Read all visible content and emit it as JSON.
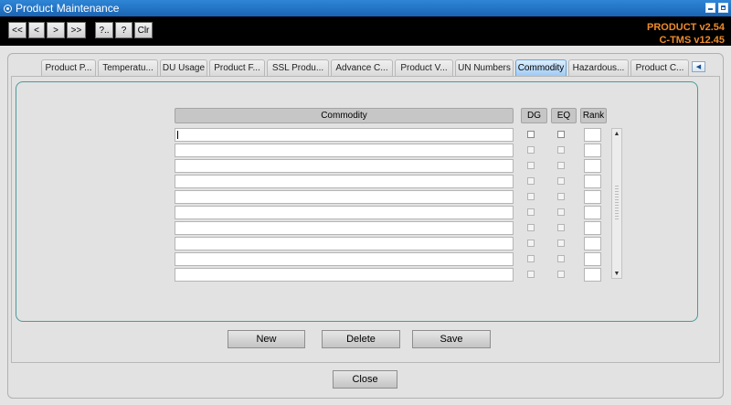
{
  "window": {
    "title": "Product Maintenance",
    "version_line1": "PRODUCT v2.54",
    "version_line2": "C-TMS v12.45"
  },
  "toolbar": {
    "first": "<<",
    "prev": "<",
    "next": ">",
    "last": ">>",
    "query_dots": "?..",
    "query": "?",
    "clear": "Clr"
  },
  "tabs": [
    {
      "label": "Product P...",
      "active": false
    },
    {
      "label": "Temperatu...",
      "active": false
    },
    {
      "label": "DU Usage",
      "active": false
    },
    {
      "label": "Product F...",
      "active": false
    },
    {
      "label": "SSL Produ...",
      "active": false
    },
    {
      "label": "Advance C...",
      "active": false
    },
    {
      "label": "Product V...",
      "active": false
    },
    {
      "label": "UN Numbers",
      "active": false
    },
    {
      "label": "Commodity",
      "active": true
    },
    {
      "label": "Hazardous...",
      "active": false
    },
    {
      "label": "Product C...",
      "active": false
    }
  ],
  "tab_scroll_icon": "chevron-left-icon",
  "grid": {
    "headers": {
      "commodity": "Commodity",
      "dg": "DG",
      "eq": "EQ",
      "rank": "Rank"
    },
    "rows": [
      {
        "commodity": "",
        "dg": false,
        "eq": false,
        "rank": ""
      },
      {
        "commodity": "",
        "dg": false,
        "eq": false,
        "rank": ""
      },
      {
        "commodity": "",
        "dg": false,
        "eq": false,
        "rank": ""
      },
      {
        "commodity": "",
        "dg": false,
        "eq": false,
        "rank": ""
      },
      {
        "commodity": "",
        "dg": false,
        "eq": false,
        "rank": ""
      },
      {
        "commodity": "",
        "dg": false,
        "eq": false,
        "rank": ""
      },
      {
        "commodity": "",
        "dg": false,
        "eq": false,
        "rank": ""
      },
      {
        "commodity": "",
        "dg": false,
        "eq": false,
        "rank": ""
      },
      {
        "commodity": "",
        "dg": false,
        "eq": false,
        "rank": ""
      },
      {
        "commodity": "",
        "dg": false,
        "eq": false,
        "rank": ""
      }
    ]
  },
  "actions": {
    "new": "New",
    "delete": "Delete",
    "save": "Save"
  },
  "close_label": "Close",
  "colors": {
    "titlebar": "#1a63b4",
    "version_text": "#ef8a2b",
    "active_tab": "#9fcaf3",
    "frame_border": "#4b9a9a"
  }
}
